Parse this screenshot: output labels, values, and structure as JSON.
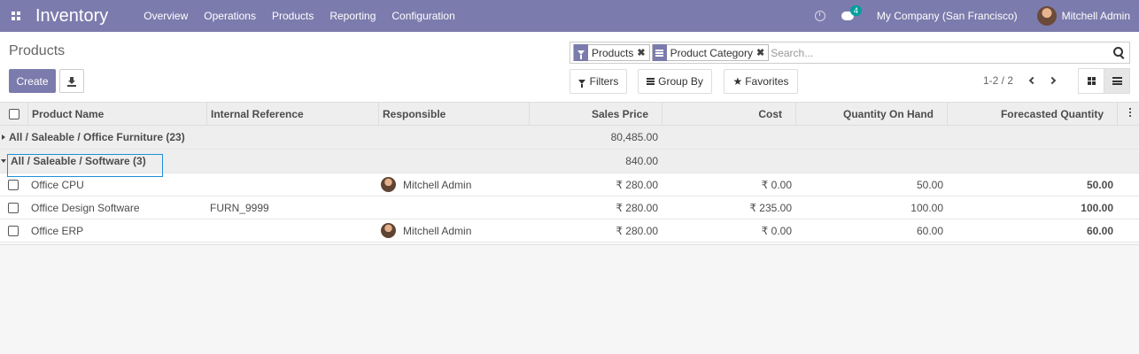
{
  "navbar": {
    "app_name": "Inventory",
    "menu": [
      "Overview",
      "Operations",
      "Products",
      "Reporting",
      "Configuration"
    ],
    "chat_badge": "4",
    "company": "My Company (San Francisco)",
    "user": "Mitchell Admin"
  },
  "control": {
    "title": "Products",
    "create_label": "Create",
    "facets": [
      {
        "label": "Products",
        "icon": "filter-icon"
      },
      {
        "label": "Product Category",
        "icon": "group-by-icon"
      }
    ],
    "search_placeholder": "Search...",
    "filters_label": "Filters",
    "groupby_label": "Group By",
    "favorites_label": "Favorites",
    "pager": "1-2 / 2"
  },
  "table": {
    "columns": [
      "Product Name",
      "Internal Reference",
      "Responsible",
      "Sales Price",
      "Cost",
      "Quantity On Hand",
      "Forecasted Quantity"
    ],
    "groups": [
      {
        "title": "All / Saleable / Office Furniture (23)",
        "sales_total": "80,485.00"
      },
      {
        "title": "All / Saleable / Software (3)",
        "sales_total": "840.00"
      }
    ],
    "rows": [
      {
        "name": "Office CPU",
        "ref": "",
        "responsible": "Mitchell Admin",
        "price": "₹ 280.00",
        "cost": "₹ 0.00",
        "on_hand": "50.00",
        "forecast": "50.00"
      },
      {
        "name": "Office Design Software",
        "ref": "FURN_9999",
        "responsible": "",
        "price": "₹ 280.00",
        "cost": "₹ 235.00",
        "on_hand": "100.00",
        "forecast": "100.00"
      },
      {
        "name": "Office ERP",
        "ref": "",
        "responsible": "Mitchell Admin",
        "price": "₹ 280.00",
        "cost": "₹ 0.00",
        "on_hand": "60.00",
        "forecast": "60.00"
      }
    ]
  },
  "colors": {
    "brand": "#7c7bad",
    "badge": "#00a09d",
    "highlight": "#1e90d6"
  }
}
